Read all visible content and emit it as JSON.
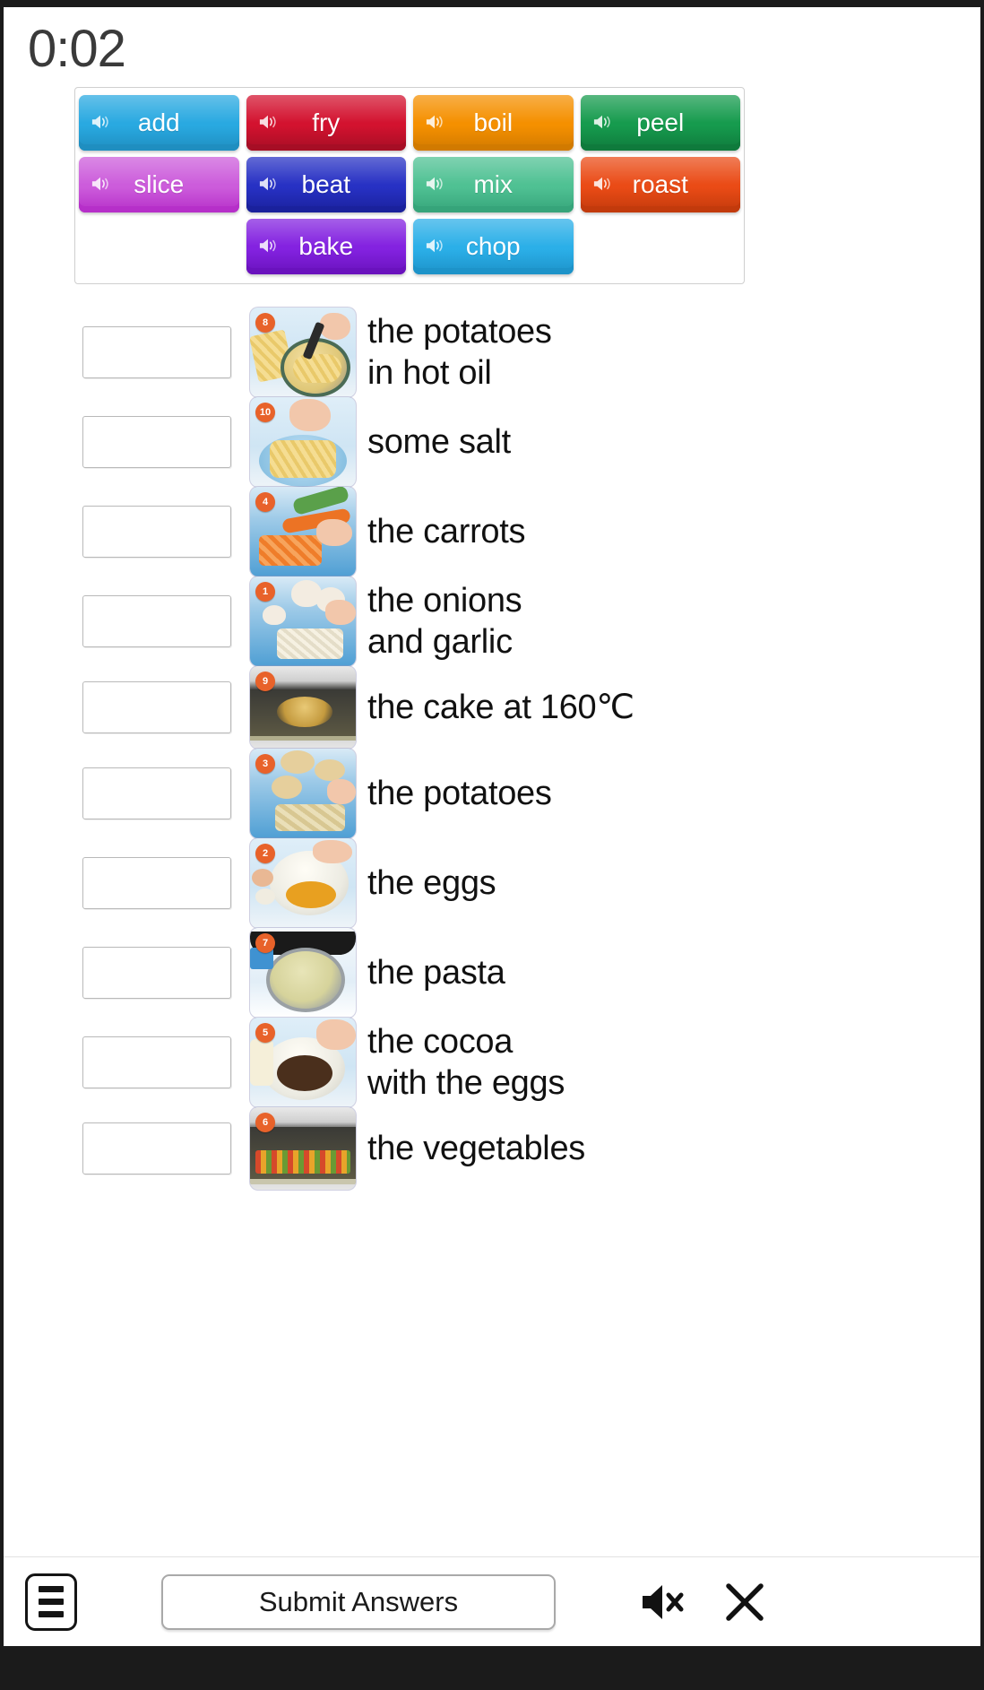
{
  "timer": {
    "value": "0:02"
  },
  "word_bank": {
    "rows": [
      [
        {
          "label": "add",
          "color": "#29a9e1",
          "color_dark": "#1f8ec0",
          "icon": "speaker-icon"
        },
        {
          "label": "fry",
          "color": "#d3122f",
          "color_dark": "#a60e25",
          "icon": "speaker-icon"
        },
        {
          "label": "boil",
          "color": "#f59000",
          "color_dark": "#d17a00",
          "icon": "speaker-icon"
        },
        {
          "label": "peel",
          "color": "#169b4e",
          "color_dark": "#0f7a3c",
          "icon": "speaker-icon"
        }
      ],
      [
        {
          "label": "slice",
          "color": "#cc5cdb",
          "color_dark": "#b62fc9",
          "icon": "speaker-icon"
        },
        {
          "label": "beat",
          "color": "#2731c4",
          "color_dark": "#1a219c",
          "icon": "speaker-icon"
        },
        {
          "label": "mix",
          "color": "#4fc193",
          "color_dark": "#36a47a",
          "icon": "speaker-icon"
        },
        {
          "label": "roast",
          "color": "#ea4b16",
          "color_dark": "#c23a0c",
          "icon": "speaker-icon"
        }
      ],
      [
        {
          "label": "bake",
          "color": "#8322e0",
          "color_dark": "#6a12bd",
          "icon": "speaker-icon"
        },
        {
          "label": "chop",
          "color": "#2bafe8",
          "color_dark": "#1d93c9",
          "icon": "speaker-icon"
        }
      ]
    ]
  },
  "exercise": {
    "items": [
      {
        "badge": "8",
        "phrase": "the potatoes\nin hot oil",
        "answer": "",
        "scene": "fry-potatoes"
      },
      {
        "badge": "10",
        "phrase": "some salt",
        "answer": "",
        "scene": "add-salt"
      },
      {
        "badge": "4",
        "phrase": "the carrots",
        "answer": "",
        "scene": "chop-carrots"
      },
      {
        "badge": "1",
        "phrase": "the onions\nand garlic",
        "answer": "",
        "scene": "chop-garlic"
      },
      {
        "badge": "9",
        "phrase": "the cake at 160℃",
        "answer": "",
        "scene": "bake-cake"
      },
      {
        "badge": "3",
        "phrase": "the potatoes",
        "answer": "",
        "scene": "peel-potatoes"
      },
      {
        "badge": "2",
        "phrase": "the eggs",
        "answer": "",
        "scene": "beat-eggs"
      },
      {
        "badge": "7",
        "phrase": "the pasta",
        "answer": "",
        "scene": "boil-pasta"
      },
      {
        "badge": "5",
        "phrase": "the cocoa\nwith the eggs",
        "answer": "",
        "scene": "mix-cocoa"
      },
      {
        "badge": "6",
        "phrase": "the vegetables",
        "answer": "",
        "scene": "roast-vegetables"
      }
    ]
  },
  "bottom_bar": {
    "menu_icon": "hamburger-menu-icon",
    "submit_label": "Submit Answers",
    "mute_icon": "speaker-muted-icon",
    "close_icon": "close-x-icon"
  },
  "colors": {
    "badge": "#e8622a",
    "timer_text": "#3a3a3a",
    "page_background": "#ffffff",
    "frame": "#1b1b1b"
  }
}
